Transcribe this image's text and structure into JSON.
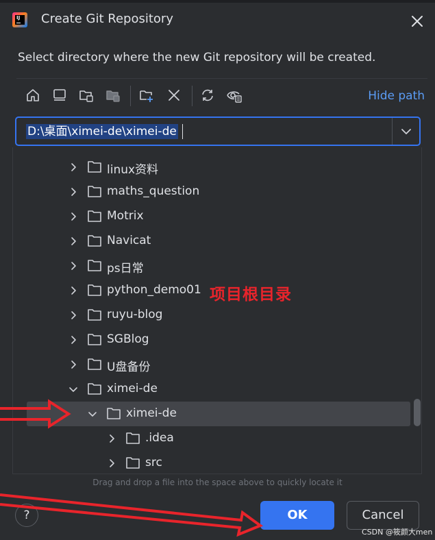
{
  "dialog": {
    "title": "Create Git Repository",
    "description": "Select directory where the new Git repository will be created.",
    "icons": [
      "app-logo-icon",
      "close-icon"
    ]
  },
  "toolbar": {
    "icons": [
      "home-icon",
      "desktop-icon",
      "project-folder-icon",
      "module-folder-icon",
      "new-folder-icon",
      "delete-icon",
      "refresh-icon",
      "show-hidden-icon"
    ],
    "hide_path": "Hide path"
  },
  "path": {
    "value": "D:\\桌面\\ximei-de\\ximei-de"
  },
  "tree": {
    "items": [
      {
        "label": "linux资料",
        "expanded": false,
        "selected": false
      },
      {
        "label": "maths_question",
        "expanded": false,
        "selected": false
      },
      {
        "label": "Motrix",
        "expanded": false,
        "selected": false
      },
      {
        "label": "Navicat",
        "expanded": false,
        "selected": false
      },
      {
        "label": "ps日常",
        "expanded": false,
        "selected": false
      },
      {
        "label": "python_demo01",
        "expanded": false,
        "selected": false
      },
      {
        "label": "ruyu-blog",
        "expanded": false,
        "selected": false
      },
      {
        "label": "SGBlog",
        "expanded": false,
        "selected": false
      },
      {
        "label": "U盘备份",
        "expanded": false,
        "selected": false
      },
      {
        "label": "ximei-de",
        "expanded": true,
        "selected": false
      },
      {
        "label": "ximei-de",
        "expanded": true,
        "selected": true
      },
      {
        "label": ".idea",
        "expanded": false,
        "selected": false
      },
      {
        "label": "src",
        "expanded": false,
        "selected": false
      }
    ]
  },
  "annotation": {
    "text": "项目根目录",
    "color": "#e8242b"
  },
  "hint": "Drag and drop a file into the space above to quickly locate it",
  "buttons": {
    "help": "?",
    "ok": "OK",
    "cancel": "Cancel"
  },
  "watermark": "CSDN @筱颜大men",
  "colors": {
    "background": "#2b2d30",
    "accent": "#3574f0",
    "link": "#5b9cf5",
    "selection": "#43454a"
  }
}
